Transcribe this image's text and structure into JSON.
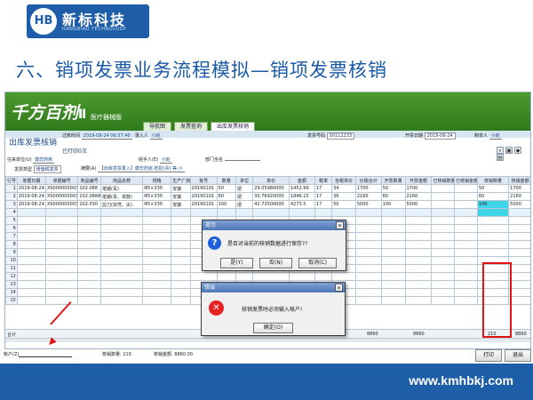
{
  "brand": {
    "cn": "新标科技",
    "en": "HANGBIAO TECHNOLOGY",
    "mark": "HB"
  },
  "slide_title": "六、销项发票业务流程模拟—销项发票核销",
  "app": {
    "brand_main": "千方百剂",
    "brand_suffix": "Ⅱ",
    "subtitle": "医疗器械版",
    "tabs": [
      "导航图",
      "发票查询",
      "出库发票核销"
    ],
    "pane_title": "出库发票核销",
    "printed": "已打印0次",
    "meta": {
      "doc_date_label": "过账时间",
      "doc_date": "2019-08-24 06:37:40",
      "entry_label": "录入人",
      "entry": "小赵",
      "invoice_no_label": "发票号码",
      "invoice_no": "00112233",
      "invoice_date_label": "开票日期",
      "invoice_date": "2019-08-24",
      "maker_label": "制单人",
      "maker": "小赵",
      "unit_label": "往来单位(U)",
      "unit": "康恋药房",
      "handler_label": "经手人(E)",
      "handler": "小赵",
      "dept_label": "部门全名",
      "dept": "",
      "invoice_type_label": "发票类型",
      "invoice_type": "增值税发票",
      "summary_label": "摘要(A)",
      "summary": "【出库发票录入】康恋药房,抵捏(青) 等.小"
    },
    "table": {
      "headers": [
        "行号",
        "单据日期",
        "单据编号",
        "商品编号",
        "商品名称",
        "规格",
        "生产厂商",
        "批号",
        "数量",
        "单位",
        "单价",
        "金额",
        "税率",
        "含税单价",
        "价税合计",
        "开票数量",
        "开票金额",
        "已核销数量",
        "已核销金额",
        "核销数量",
        "核销金额"
      ],
      "rows": [
        [
          "1",
          "2019-08-24",
          "XS000000003",
          "102.088",
          "抵镊(青)",
          "Φ5×330",
          "安徽",
          "20190101",
          "50",
          "把",
          "29.05980000",
          "1452.99",
          "17",
          "34",
          "1700",
          "50",
          "1700",
          "",
          "",
          "50",
          "1700"
        ],
        [
          "2",
          "2019-08-24",
          "XS000000003",
          "102.088A",
          "抵镊(青、单鼓)",
          "Φ5×330",
          "安徽",
          "20190101",
          "60",
          "把",
          "30.76920000",
          "1846.15",
          "17",
          "36",
          "2160",
          "60",
          "2160",
          "",
          "",
          "60",
          "2160"
        ],
        [
          "3",
          "2019-08-24",
          "XS000000003",
          "102.030",
          "剪刀(双弯、尖)",
          "Φ5×330",
          "安徽",
          "20190101",
          "100",
          "把",
          "42.73500000",
          "4273.5",
          "17",
          "50",
          "5000",
          "100",
          "5000",
          "",
          "",
          "100",
          "5000"
        ]
      ],
      "current_row": "4",
      "empty_rows": [
        "5",
        "6",
        "7",
        "8",
        "9",
        "10",
        "11",
        "12",
        "13",
        "14",
        "15"
      ],
      "sum_label": "合计",
      "sum_amount": "8860",
      "sum_open": "8860",
      "sum_qty": "210",
      "sum_total": "8860"
    },
    "bottom": {
      "account_label": "帐户(Z)",
      "qty_label": "核销数量:",
      "qty": "210",
      "amount_label": "核销金额:",
      "amount": "8860.00",
      "print_button": "打印",
      "exit_button": "退出"
    },
    "dialog_confirm": {
      "title": "提示",
      "message": "是否对当前的核销数据进行保存??",
      "yes": "是(Y)",
      "no": "否(N)",
      "cancel": "取消(C)"
    },
    "dialog_error": {
      "title": "错误",
      "message": "核销发票时必须输入帐户!",
      "ok": "确定(O)"
    }
  },
  "footer_url": "www.kmhbkj.com",
  "colors": {
    "primary_blue": "#1e5ea8",
    "app_green": "#3f8a26",
    "highlight_red": "#e11414",
    "cell_cyan": "#3fd4e8"
  }
}
